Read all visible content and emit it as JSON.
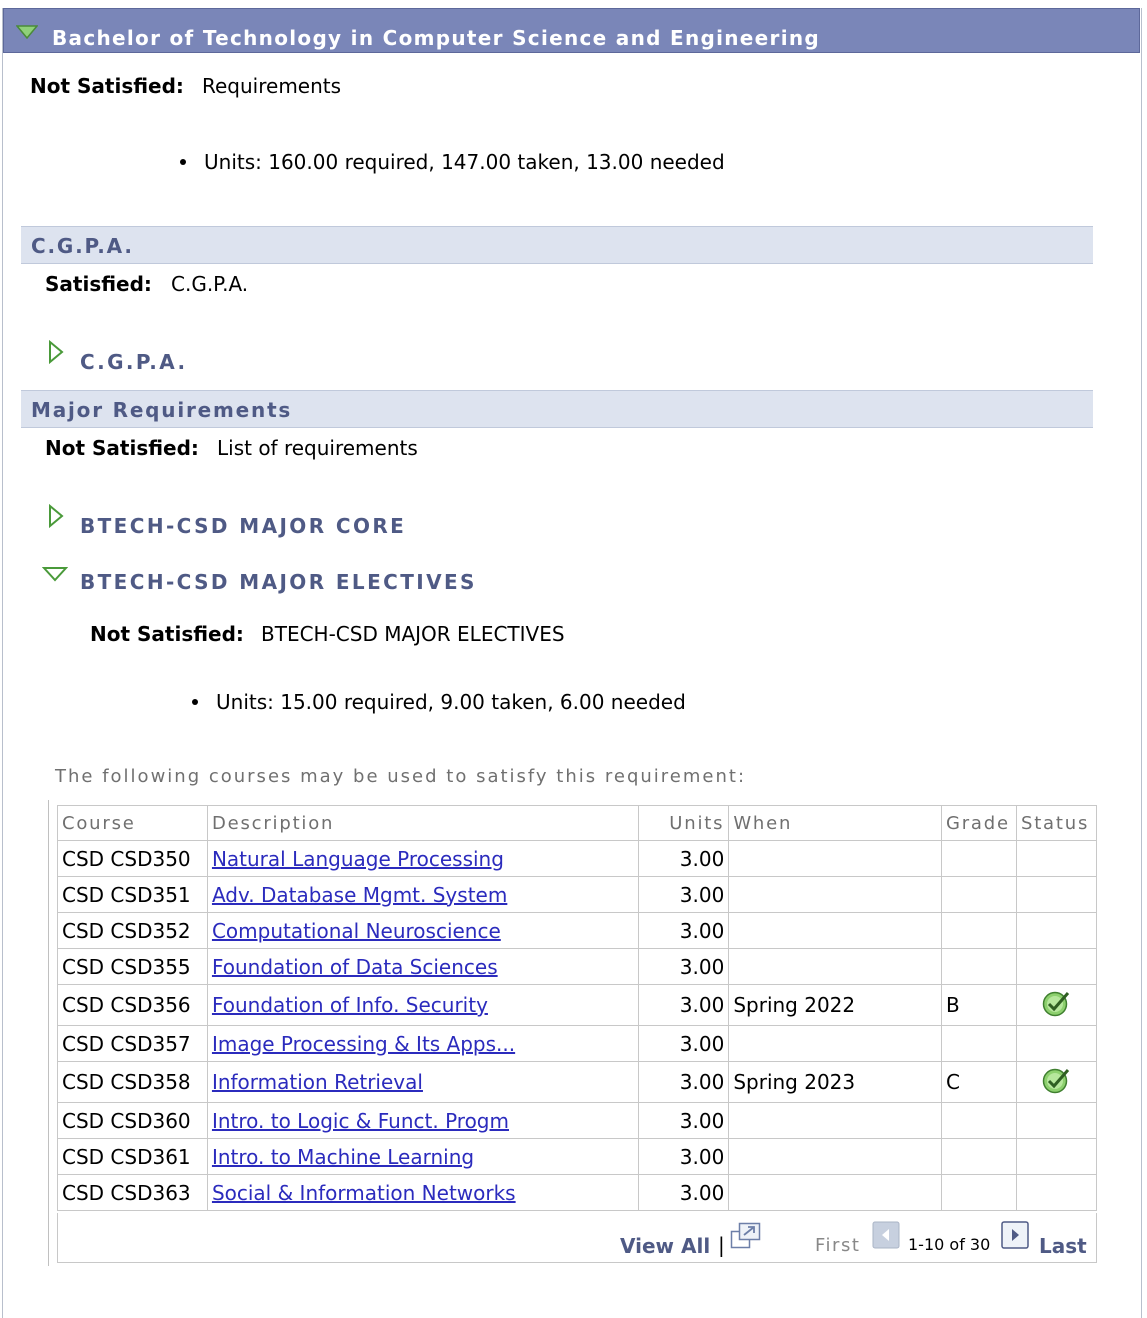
{
  "program": {
    "title": "Bachelor of Technology in Computer Science and Engineering",
    "status_label": "Not Satisfied:",
    "status_text": "Requirements",
    "units_line": "Units: 160.00 required, 147.00 taken, 13.00 needed"
  },
  "cgpa_section": {
    "header": "C.G.P.A.",
    "status_label": "Satisfied:",
    "status_text": "C.G.P.A.",
    "group_title": "C.G.P.A."
  },
  "major_section": {
    "header": "Major Requirements",
    "status_label": "Not Satisfied:",
    "status_text": "List of requirements",
    "core_title": "BTECH-CSD MAJOR CORE",
    "electives_title": "BTECH-CSD MAJOR ELECTIVES",
    "electives_status_label": "Not Satisfied:",
    "electives_status_text": "BTECH-CSD MAJOR ELECTIVES",
    "electives_units_line": "Units: 15.00 required, 9.00 taken, 6.00 needed",
    "courses_caption": "The following courses may be used to satisfy this requirement:"
  },
  "course_table": {
    "headers": {
      "course": "Course",
      "description": "Description",
      "units": "Units",
      "when": "When",
      "grade": "Grade",
      "status": "Status"
    },
    "rows": [
      {
        "course": "CSD CSD350",
        "description": "Natural Language Processing",
        "units": "3.00",
        "when": "",
        "grade": "",
        "completed": false
      },
      {
        "course": "CSD CSD351",
        "description": "Adv. Database Mgmt. System",
        "units": "3.00",
        "when": "",
        "grade": "",
        "completed": false
      },
      {
        "course": "CSD CSD352",
        "description": "Computational Neuroscience",
        "units": "3.00",
        "when": "",
        "grade": "",
        "completed": false
      },
      {
        "course": "CSD CSD355",
        "description": "Foundation of Data Sciences",
        "units": "3.00",
        "when": "",
        "grade": "",
        "completed": false
      },
      {
        "course": "CSD CSD356",
        "description": "Foundation of Info. Security",
        "units": "3.00",
        "when": "Spring 2022",
        "grade": "B",
        "completed": true
      },
      {
        "course": "CSD CSD357",
        "description": "Image Processing & Its Apps...",
        "units": "3.00",
        "when": "",
        "grade": "",
        "completed": false
      },
      {
        "course": "CSD CSD358",
        "description": "Information Retrieval",
        "units": "3.00",
        "when": "Spring 2023",
        "grade": "C",
        "completed": true
      },
      {
        "course": "CSD CSD360",
        "description": "Intro. to Logic & Funct. Progm",
        "units": "3.00",
        "when": "",
        "grade": "",
        "completed": false
      },
      {
        "course": "CSD CSD361",
        "description": "Intro. to Machine Learning",
        "units": "3.00",
        "when": "",
        "grade": "",
        "completed": false
      },
      {
        "course": "CSD CSD363",
        "description": "Social & Information Networks",
        "units": "3.00",
        "when": "",
        "grade": "",
        "completed": false
      }
    ],
    "nav": {
      "view_all": "View All",
      "separator": "|",
      "first": "First",
      "range": "1-10 of 30",
      "last": "Last"
    }
  },
  "colors": {
    "header_bar": "#7a86b8",
    "section_bar": "#dde3ef",
    "section_text": "#4f5a85",
    "link": "#2b2bbd",
    "check_green": "#4caf2f"
  },
  "icons": {
    "expanded": "triangle-down-icon",
    "collapsed": "triangle-right-icon",
    "completed": "green-check-icon",
    "popout": "popout-icon",
    "prev": "prev-arrow-icon",
    "next": "next-arrow-icon"
  }
}
